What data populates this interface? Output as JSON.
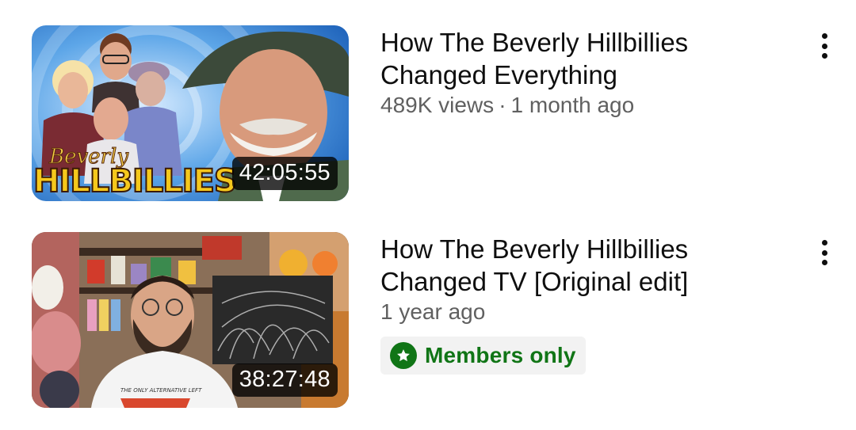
{
  "videos": [
    {
      "title_line1": "How The Beverly Hillbillies",
      "title_line2": "Changed Everything",
      "views": "489K views",
      "separator": "·",
      "age": "1 month ago",
      "duration": "42:05:55",
      "thumbnail_text_script": "Beverly",
      "thumbnail_text_block": "HILLBILLIES"
    },
    {
      "title_line1": "How The Beverly Hillbillies",
      "title_line2": "Changed TV [Original edit]",
      "age": "1 year ago",
      "duration": "38:27:48",
      "badge_label": "Members only",
      "badge_icon": "star-icon",
      "shirt_text": "THE ONLY ALTERNATIVE LEFT"
    }
  ],
  "colors": {
    "members_green": "#107516",
    "secondary_text": "#606060",
    "primary_text": "#0f0f0f"
  },
  "icons": {
    "more": "more-vert-icon"
  }
}
